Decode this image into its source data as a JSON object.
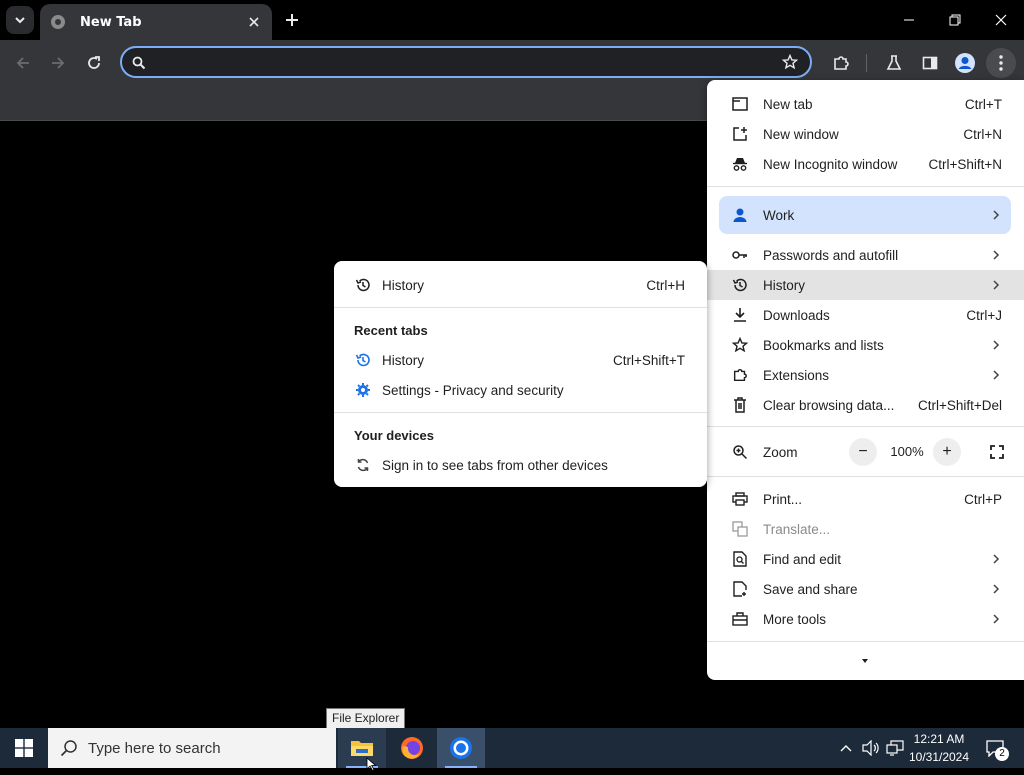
{
  "browser": {
    "tab_title": "New Tab",
    "omnibox_value": "",
    "omnibox_placeholder": ""
  },
  "menu": {
    "items_top": [
      {
        "label": "New tab",
        "shortcut": "Ctrl+T"
      },
      {
        "label": "New window",
        "shortcut": "Ctrl+N"
      },
      {
        "label": "New Incognito window",
        "shortcut": "Ctrl+Shift+N"
      }
    ],
    "profile": {
      "label": "Work"
    },
    "items_mid": [
      {
        "label": "Passwords and autofill",
        "shortcut": ""
      },
      {
        "label": "History",
        "shortcut": ""
      },
      {
        "label": "Downloads",
        "shortcut": "Ctrl+J"
      },
      {
        "label": "Bookmarks and lists",
        "shortcut": ""
      },
      {
        "label": "Extensions",
        "shortcut": ""
      },
      {
        "label": "Clear browsing data...",
        "shortcut": "Ctrl+Shift+Del"
      }
    ],
    "zoom": {
      "label": "Zoom",
      "value": "100%",
      "minus": "−",
      "plus": "+"
    },
    "items_bottom": [
      {
        "label": "Print...",
        "shortcut": "Ctrl+P"
      },
      {
        "label": "Translate...",
        "shortcut": ""
      },
      {
        "label": "Find and edit",
        "shortcut": ""
      },
      {
        "label": "Save and share",
        "shortcut": ""
      },
      {
        "label": "More tools",
        "shortcut": ""
      }
    ]
  },
  "history_submenu": {
    "history": {
      "label": "History",
      "shortcut": "Ctrl+H"
    },
    "recent_tabs_heading": "Recent tabs",
    "recent": [
      {
        "label": "History",
        "shortcut": "Ctrl+Shift+T"
      },
      {
        "label": "Settings - Privacy and security",
        "shortcut": ""
      }
    ],
    "devices_heading": "Your devices",
    "devices_item": "Sign in to see tabs from other devices"
  },
  "tooltip": "File Explorer",
  "taskbar": {
    "search_placeholder": "Type here to search",
    "time": "12:21 AM",
    "date": "10/31/2024",
    "notification_count": "2"
  },
  "colors": {
    "accent": "#7cacf8",
    "menu_highlight": "#e3e3e3",
    "profile_bg": "#d3e3fd",
    "taskbar": "#1c2a3a"
  }
}
